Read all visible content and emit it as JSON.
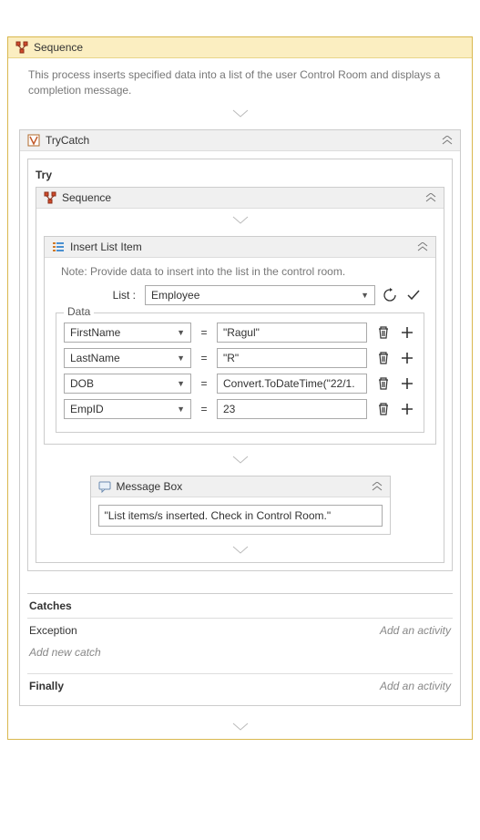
{
  "outer": {
    "title": "Sequence",
    "description": "This process inserts specified data into a list of the user Control Room and displays a completion message."
  },
  "tryCatch": {
    "title": "TryCatch",
    "tryLabel": "Try",
    "catches_label": "Catches",
    "exception_label": "Exception",
    "add_activity": "Add an activity",
    "add_new_catch": "Add new catch",
    "finally_label": "Finally"
  },
  "innerSeq": {
    "title": "Sequence"
  },
  "insert": {
    "title": "Insert List Item",
    "note": "Note: Provide data to insert into the list in the control room.",
    "list_label": "List :",
    "list_value": "Employee",
    "data_label": "Data",
    "rows": [
      {
        "field": "FirstName",
        "value": "\"Ragul\""
      },
      {
        "field": "LastName",
        "value": "\"R\""
      },
      {
        "field": "DOB",
        "value": "Convert.ToDateTime(\"22/1."
      },
      {
        "field": "EmpID",
        "value": "23"
      }
    ]
  },
  "msgbox": {
    "title": "Message Box",
    "value": "\"List items/s inserted. Check in Control Room.\""
  },
  "eq": "="
}
